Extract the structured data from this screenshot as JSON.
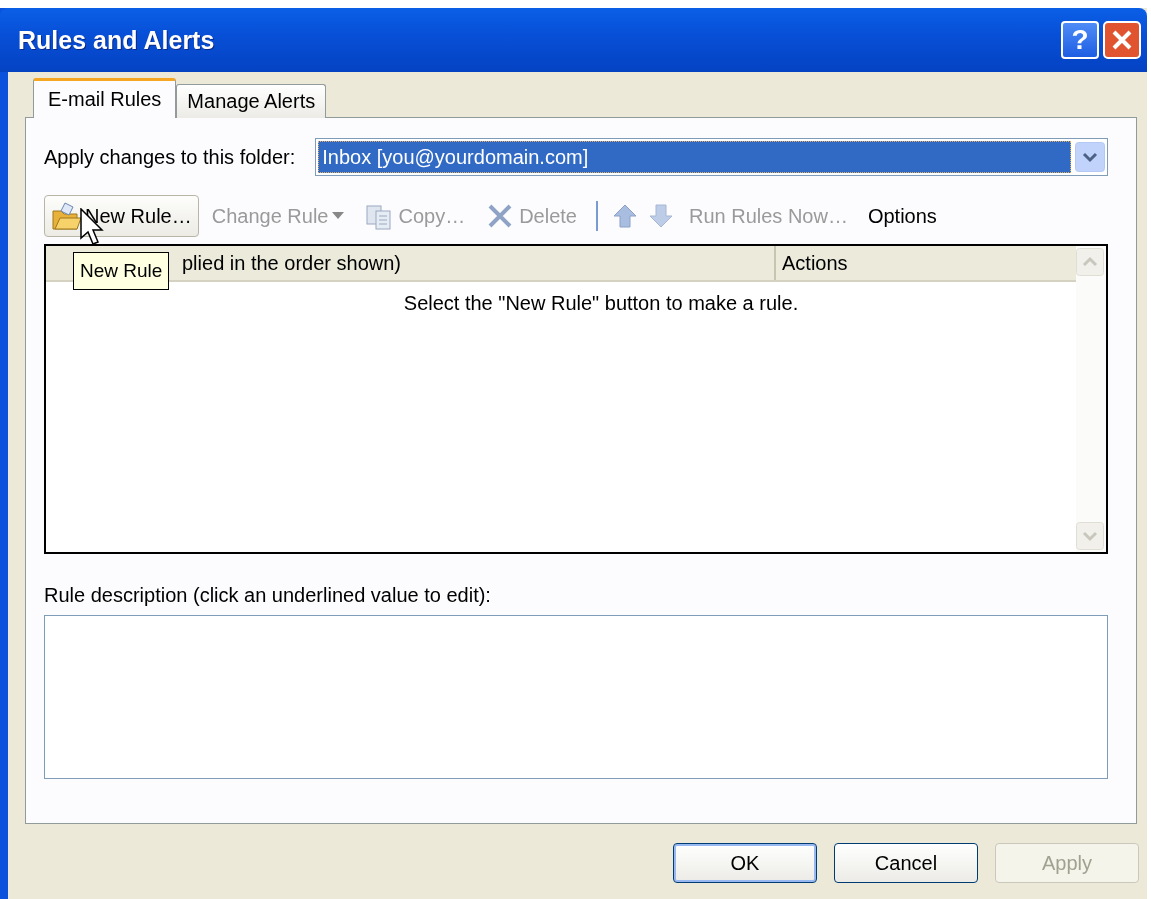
{
  "window": {
    "title": "Rules and Alerts",
    "help": "?"
  },
  "tabs": [
    {
      "label": "E-mail Rules",
      "selected": true
    },
    {
      "label": "Manage Alerts",
      "selected": false
    }
  ],
  "folder": {
    "label": "Apply changes to this folder:",
    "value": "Inbox [you@yourdomain.com]"
  },
  "toolbar": [
    {
      "kind": "button",
      "label": "New Rule…",
      "disabled": false,
      "hovered": true
    },
    {
      "kind": "menu",
      "label": "Change Rule",
      "disabled": true,
      "hovered": false
    },
    {
      "kind": "button",
      "label": "Copy…",
      "disabled": true,
      "hovered": false
    },
    {
      "kind": "button",
      "label": "Delete",
      "disabled": true,
      "hovered": false
    },
    {
      "kind": "separator"
    },
    {
      "kind": "icon",
      "disabled": false,
      "hovered": false
    },
    {
      "kind": "icon",
      "disabled": true,
      "hovered": false
    },
    {
      "kind": "button",
      "label": "Run Rules Now…",
      "disabled": true,
      "hovered": false
    },
    {
      "kind": "button",
      "label": "Options",
      "disabled": false,
      "hovered": false
    }
  ],
  "tooltip": "New Rule",
  "rule_list": {
    "columns": [
      "plied in the order shown)",
      "Actions"
    ],
    "empty_message": "Select the \"New Rule\" button to make a rule."
  },
  "description": {
    "label": "Rule description (click an underlined value to edit):"
  },
  "buttons": [
    {
      "label": "OK",
      "default": true,
      "disabled": false
    },
    {
      "label": "Cancel",
      "default": false,
      "disabled": false
    },
    {
      "label": "Apply",
      "default": false,
      "disabled": true
    }
  ]
}
